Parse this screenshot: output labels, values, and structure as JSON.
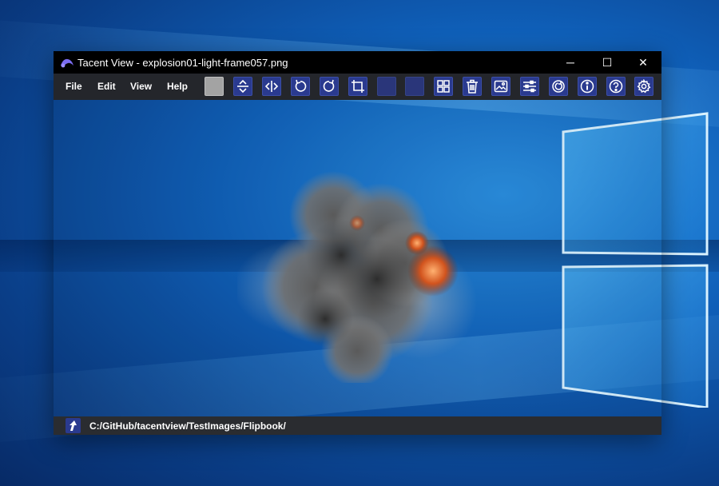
{
  "window": {
    "title": "Tacent View - explosion01-light-frame057.png",
    "controls": {
      "minimize": "─",
      "maximize": "☐",
      "close": "✕"
    }
  },
  "menu": {
    "items": [
      {
        "label": "File"
      },
      {
        "label": "Edit"
      },
      {
        "label": "View"
      },
      {
        "label": "Help"
      }
    ]
  },
  "toolbar": {
    "buttons": [
      {
        "icon": "background-swatch-icon"
      },
      {
        "icon": "flip-vertical-icon"
      },
      {
        "icon": "flip-horizontal-icon"
      },
      {
        "icon": "rotate-ccw-icon"
      },
      {
        "icon": "rotate-cw-icon"
      },
      {
        "icon": "crop-icon"
      },
      {
        "icon": "prev-icon"
      },
      {
        "icon": "next-icon"
      },
      {
        "icon": "thumbnail-grid-icon"
      },
      {
        "icon": "delete-icon"
      },
      {
        "icon": "image-save-icon"
      },
      {
        "icon": "adjust-sliders-icon"
      },
      {
        "icon": "refresh-icon"
      },
      {
        "icon": "info-icon"
      },
      {
        "icon": "help-icon"
      },
      {
        "icon": "settings-icon"
      }
    ],
    "accent": "#2a3a8f"
  },
  "status": {
    "path": "C:/GitHub/tacentview/TestImages/Flipbook/"
  },
  "colors": {
    "titlebar": "#000000",
    "menubar": "#24262b",
    "statusbar": "#2a2c30"
  }
}
